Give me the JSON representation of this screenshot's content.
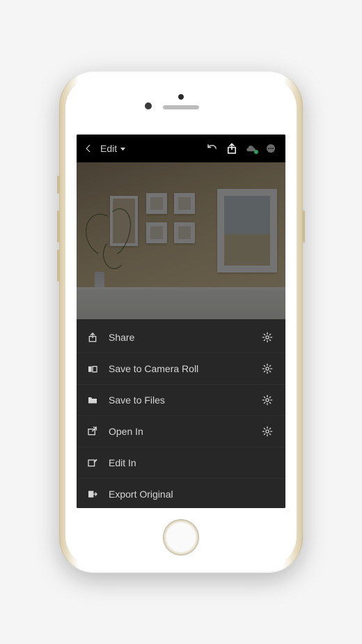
{
  "topbar": {
    "title": "Edit",
    "icons": {
      "back": "chevron-left",
      "dropdown": "triangle-down",
      "undo": "undo",
      "share": "share",
      "cloud": "cloud-sync",
      "more": "more"
    },
    "cloud_dot_color": "#2e9e5b"
  },
  "menu": {
    "items": [
      {
        "icon": "share-up-icon",
        "label": "Share",
        "has_gear": true
      },
      {
        "icon": "camera-roll-icon",
        "label": "Save to Camera Roll",
        "has_gear": true
      },
      {
        "icon": "folder-icon",
        "label": "Save to Files",
        "has_gear": true
      },
      {
        "icon": "open-in-icon",
        "label": "Open In",
        "has_gear": true
      },
      {
        "icon": "edit-in-icon",
        "label": "Edit In",
        "has_gear": false
      },
      {
        "icon": "export-original-icon",
        "label": "Export Original",
        "has_gear": false
      }
    ]
  },
  "colors": {
    "menu_bg": "#272727",
    "text": "#d6d6d6",
    "topbar_bg": "#000000",
    "share_icon_highlight": "#ffffff"
  }
}
